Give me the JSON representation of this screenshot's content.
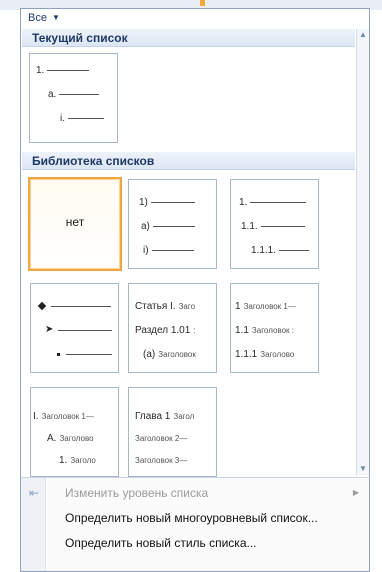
{
  "gallery": {
    "filter_label": "Все",
    "sections": {
      "current": "Текущий список",
      "library": "Библиотека списков"
    },
    "current_list": {
      "levels": [
        "1.",
        "a.",
        "i."
      ]
    },
    "library": {
      "none_label": "нет",
      "t1": [
        "1)",
        "a)",
        "i)"
      ],
      "t2": [
        "1.",
        "1.1.",
        "1.1.1."
      ],
      "t4": [
        {
          "num": "Статья I.",
          "text": "Заго"
        },
        {
          "num": "Раздел 1.01",
          "text": ":"
        },
        {
          "num": "(a)",
          "text": "Заголовок"
        }
      ],
      "t5": [
        {
          "num": "1",
          "text": "Заголовок 1—"
        },
        {
          "num": "1.1",
          "text": "Заголовок :"
        },
        {
          "num": "1.1.1",
          "text": "Заголово"
        }
      ],
      "t6": [
        {
          "num": "I.",
          "text": "Заголовок 1—"
        },
        {
          "num": "A.",
          "text": "Заголово"
        },
        {
          "num": "1.",
          "text": "Заголо"
        }
      ],
      "t7": [
        {
          "num": "Глава 1",
          "text": "Загол"
        },
        {
          "num": "",
          "text": "Заголовок 2—"
        },
        {
          "num": "",
          "text": "Заголовок 3—"
        }
      ]
    }
  },
  "menu": {
    "change_level": "Изменить уровень списка",
    "define_multilevel": "Определить новый многоуровневый список...",
    "define_style": "Определить новый стиль списка..."
  },
  "colors": {
    "selected_border": "#f0a540",
    "section_header_text": "#1e3963",
    "disabled_text": "#9b9b9b"
  }
}
